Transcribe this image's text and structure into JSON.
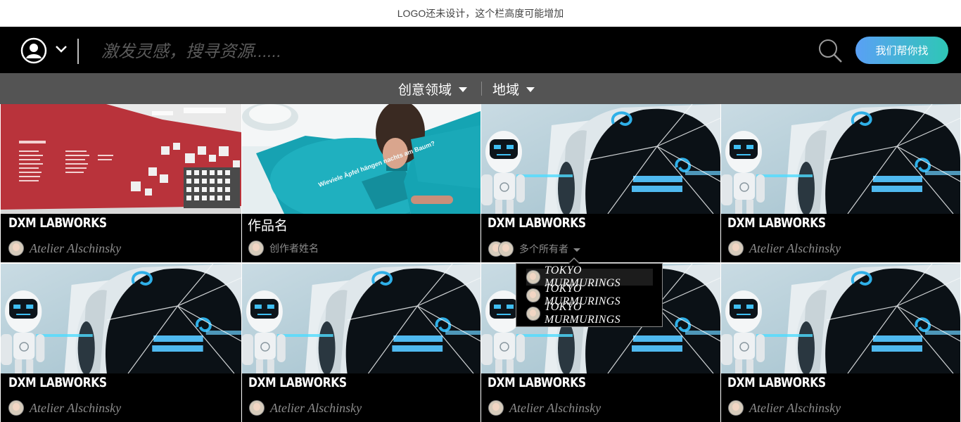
{
  "logo_bar": {
    "text": "LOGO还未设计，这个栏高度可能增加"
  },
  "header": {
    "search_placeholder": "激发灵感，搜寻资源......",
    "help_button": "我们帮你找"
  },
  "filters": [
    {
      "label": "创意领域"
    },
    {
      "label": "地域"
    }
  ],
  "cards": [
    {
      "title": "DXM LABWORKS",
      "author": "Atelier Alschinsky",
      "image": "red-gallery-wall"
    },
    {
      "title": "作品名",
      "author": "创作者姓名",
      "image": "teal-exhibit-person"
    },
    {
      "title": "DXM LABWORKS",
      "author": "多个所有者",
      "image": "robot-cracked-screen"
    },
    {
      "title": "DXM LABWORKS",
      "author": "Atelier Alschinsky",
      "image": "robot-cracked-screen"
    },
    {
      "title": "DXM LABWORKS",
      "author": "Atelier Alschinsky",
      "image": "robot-cracked-screen"
    },
    {
      "title": "DXM LABWORKS",
      "author": "Atelier Alschinsky",
      "image": "robot-cracked-screen"
    },
    {
      "title": "DXM LABWORKS",
      "author": "Atelier Alschinsky",
      "image": "robot-cracked-screen"
    },
    {
      "title": "DXM LABWORKS",
      "author": "Atelier Alschinsky",
      "image": "robot-cracked-screen"
    }
  ],
  "owners_popup": {
    "items": [
      {
        "label": "TOKYO MURMURINGS"
      },
      {
        "label": "TOKYO MURMURINGS"
      },
      {
        "label": "TOKYO MURMURINGS"
      }
    ]
  },
  "colors": {
    "header_bg": "#000000",
    "filter_bg": "#545454",
    "button_gradient_start": "#5aa0f5",
    "button_gradient_end": "#2ec7b6"
  }
}
